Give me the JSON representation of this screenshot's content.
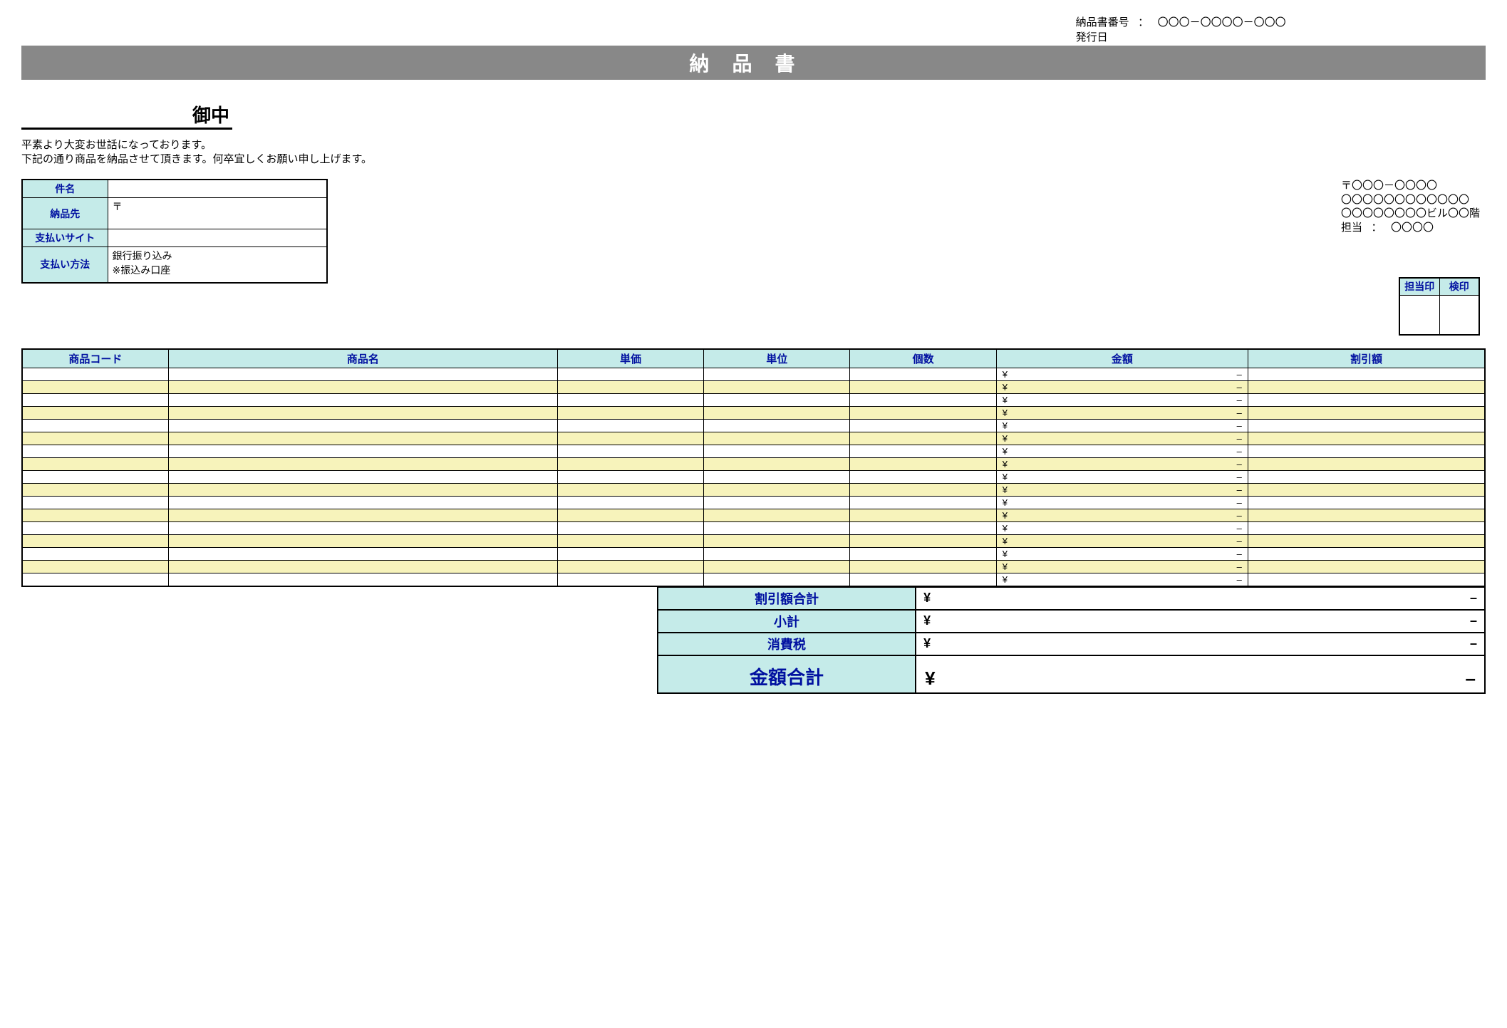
{
  "meta": {
    "doc_no_label": "納品書番号",
    "doc_no_sep": "：",
    "doc_no_value": "〇〇〇－〇〇〇〇－〇〇〇",
    "issue_label": "発行日"
  },
  "title": "納品書",
  "onchu": "御中",
  "greeting_line1": "平素より大変お世話になっております。",
  "greeting_line2": "下記の通り商品を納品させて頂きます。何卒宜しくお願い申し上げます。",
  "info": {
    "subject_label": "件名",
    "subject_value": "",
    "delivery_label": "納品先",
    "delivery_value": "〒",
    "paysite_label": "支払いサイト",
    "paysite_value": "",
    "paymethod_label": "支払い方法",
    "paymethod_line1": "銀行振り込み",
    "paymethod_line2": "※振込み口座"
  },
  "sender": {
    "postal": "〒〇〇〇－〇〇〇〇",
    "addr1": "〇〇〇〇〇〇〇〇〇〇〇〇",
    "addr2": "〇〇〇〇〇〇〇〇ビル〇〇階",
    "rep_label": "担当",
    "rep_sep": "：",
    "rep_value": "〇〇〇〇"
  },
  "stamp": {
    "col1": "担当印",
    "col2": "検印"
  },
  "items_header": {
    "code": "商品コード",
    "name": "商品名",
    "unit_price": "単価",
    "unit": "単位",
    "qty": "個数",
    "amount": "金額",
    "discount": "割引額"
  },
  "item_row": {
    "currency": "¥",
    "dash": "–"
  },
  "totals": {
    "discount_total": "割引額合計",
    "subtotal": "小計",
    "tax": "消費税",
    "grand": "金額合計",
    "currency": "¥",
    "dash": "–"
  },
  "row_count": 17
}
